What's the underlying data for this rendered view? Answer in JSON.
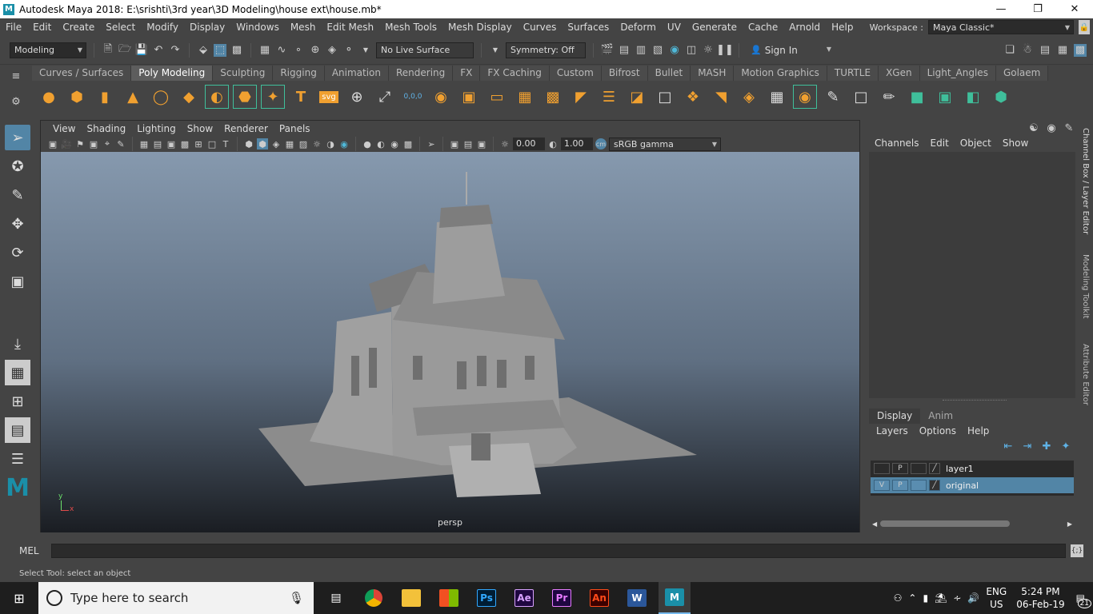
{
  "window": {
    "title": "Autodesk Maya 2018: E:\\srishti\\3rd year\\3D Modeling\\house ext\\house.mb*",
    "logo": "M"
  },
  "menubar": {
    "items": [
      "File",
      "Edit",
      "Create",
      "Select",
      "Modify",
      "Display",
      "Windows",
      "Mesh",
      "Edit Mesh",
      "Mesh Tools",
      "Mesh Display",
      "Curves",
      "Surfaces",
      "Deform",
      "UV",
      "Generate",
      "Cache",
      "Arnold",
      "Help"
    ],
    "workspace_label": "Workspace :",
    "workspace_value": "Maya Classic*"
  },
  "statusline": {
    "mode": "Modeling",
    "live_surface": "No Live Surface",
    "symmetry": "Symmetry: Off",
    "sign_in": "Sign In"
  },
  "shelf": {
    "tabs": [
      "Curves / Surfaces",
      "Poly Modeling",
      "Sculpting",
      "Rigging",
      "Animation",
      "Rendering",
      "FX",
      "FX Caching",
      "Custom",
      "Bifrost",
      "Bullet",
      "MASH",
      "Motion Graphics",
      "TURTLE",
      "XGen",
      "Light_Angles",
      "Golaem"
    ],
    "active_tab": "Poly Modeling",
    "svg_label": "svg",
    "coord_label": "0,0,0"
  },
  "viewport": {
    "menu": [
      "View",
      "Shading",
      "Lighting",
      "Show",
      "Renderer",
      "Panels"
    ],
    "exposure": "0.00",
    "gamma": "1.00",
    "colorspace": "sRGB gamma",
    "camera": "persp",
    "axis_y": "y",
    "axis_x": "x"
  },
  "channelbox": {
    "menu": [
      "Channels",
      "Edit",
      "Object",
      "Show"
    ],
    "side_tabs": [
      "Channel Box / Layer Editor",
      "Modeling Toolkit",
      "Attribute Editor"
    ]
  },
  "layer_editor": {
    "tabs": [
      "Display",
      "Anim"
    ],
    "menu": [
      "Layers",
      "Options",
      "Help"
    ],
    "layers": [
      {
        "v": "",
        "p": "P",
        "name": "layer1"
      },
      {
        "v": "V",
        "p": "P",
        "name": "original"
      }
    ]
  },
  "command": {
    "label": "MEL",
    "help": "Select Tool: select an object"
  },
  "taskbar": {
    "search_placeholder": "Type here to search",
    "apps": [
      "Ps",
      "Ae",
      "Pr",
      "An",
      "W",
      "M"
    ],
    "lang": "ENG",
    "region": "US",
    "time": "5:24 PM",
    "date": "06-Feb-19",
    "notifications": "21"
  }
}
